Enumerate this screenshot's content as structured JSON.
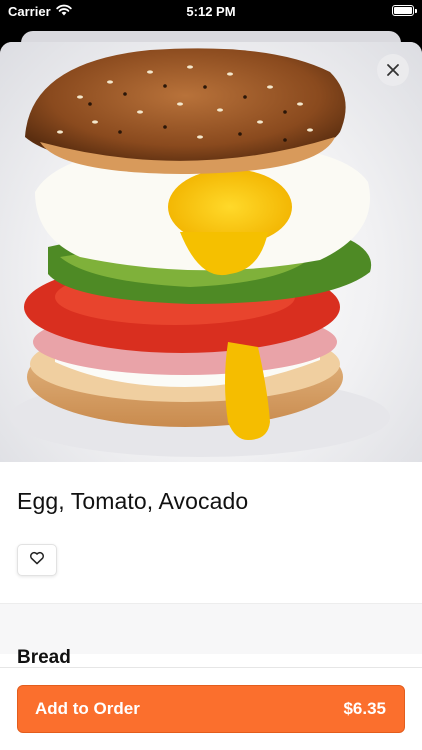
{
  "status_bar": {
    "carrier": "Carrier",
    "time": "5:12 PM"
  },
  "item": {
    "title": "Egg, Tomato, Avocado",
    "image_subject": "egg-tomato-avocado-bagel-sandwich"
  },
  "section": {
    "label": "Bread"
  },
  "footer": {
    "button_label": "Add to Order",
    "price": "$6.35"
  },
  "colors": {
    "accent": "#fb6f2d",
    "background_dark": "#000000",
    "band": "#f7f7f8"
  },
  "icons": {
    "close": "close-icon",
    "favorite": "heart-icon",
    "wifi": "wifi-icon",
    "battery": "battery-icon"
  }
}
